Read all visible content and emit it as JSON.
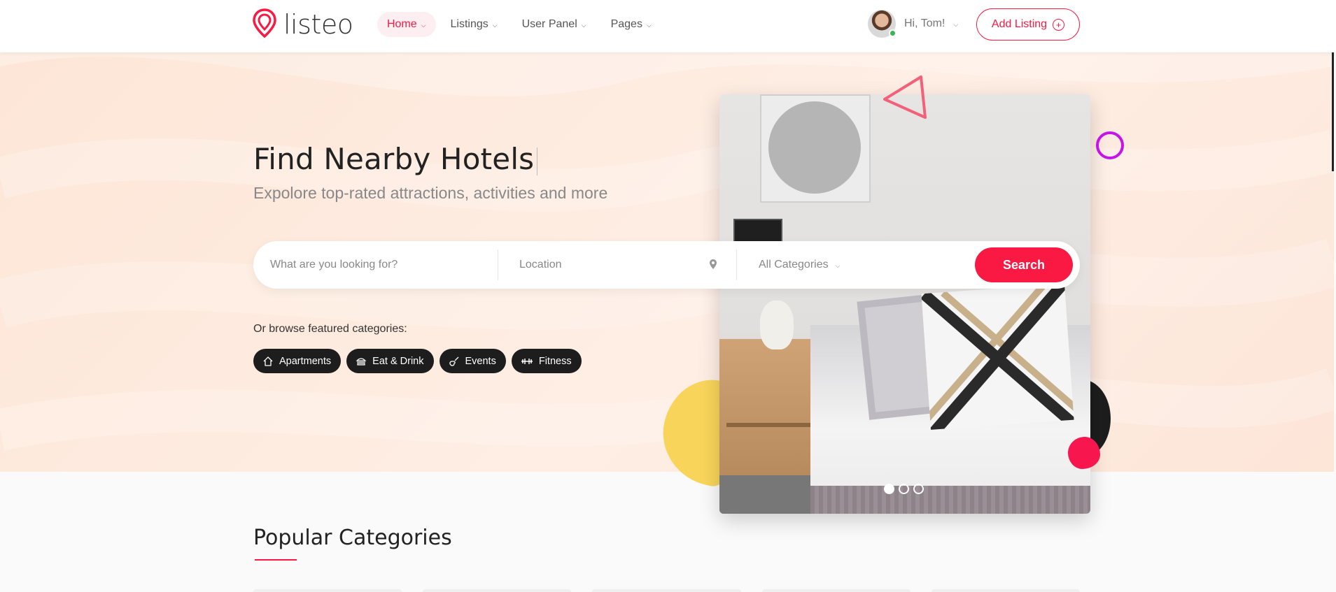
{
  "header": {
    "logo_text": "listeo",
    "nav": [
      {
        "label": "Home",
        "active": true
      },
      {
        "label": "Listings",
        "active": false
      },
      {
        "label": "User Panel",
        "active": false
      },
      {
        "label": "Pages",
        "active": false
      }
    ],
    "user_greeting": "Hi, Tom!",
    "add_listing_label": "Add Listing"
  },
  "hero": {
    "title": "Find Nearby Hotels",
    "subtitle": "Expolore top-rated attractions, activities and more",
    "slider": {
      "slides": 3,
      "active_slide": 1
    }
  },
  "search": {
    "what_placeholder": "What are you looking for?",
    "location_placeholder": "Location",
    "category_selected": "All Categories",
    "button_label": "Search"
  },
  "featured": {
    "label": "Or browse featured categories:",
    "categories": [
      {
        "label": "Apartments",
        "icon": "home-icon"
      },
      {
        "label": "Eat & Drink",
        "icon": "food-icon"
      },
      {
        "label": "Events",
        "icon": "guitar-icon"
      },
      {
        "label": "Fitness",
        "icon": "dumbbell-icon"
      }
    ]
  },
  "popular": {
    "title": "Popular Categories"
  },
  "colors": {
    "accent": "#f91942",
    "chip_bg": "#1d1d1d",
    "hero_bg": "#fde8dc",
    "accent_yellow": "#f8d55a",
    "accent_purple": "#c415e6"
  }
}
